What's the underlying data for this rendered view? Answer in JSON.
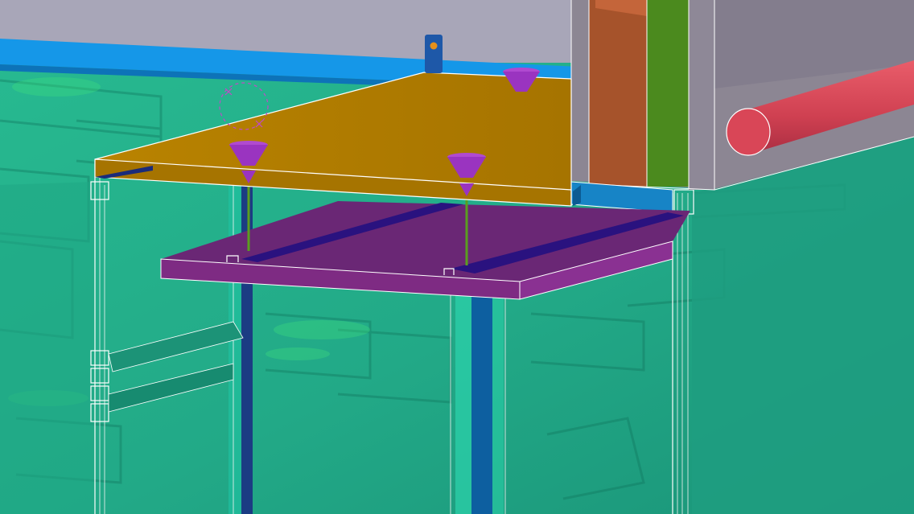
{
  "viewport": {
    "view_type": "3d-cad-model-view"
  },
  "colors": {
    "background_grey": "#a9a6b8",
    "blue_band": "#1597e8",
    "glass_teal": "#25b48e",
    "glass_deep": "#168d73",
    "slab_orange": "#b27d00",
    "slab_edge": "#9c6d00",
    "ceiling_purple": "#7e2b83",
    "ceiling_dark": "#5a2168",
    "channel_navy": "#2a127f",
    "cone_purple": "#9a34c0",
    "steel_grey": "#8c8693",
    "duct_orange": "#a6532b",
    "duct_green": "#4b8a1e",
    "pipe_red": "#d84a59",
    "column_blue": "#0d5fa0",
    "hanger_green": "#5b9d20",
    "frame_white": "#ffffff"
  },
  "model": {
    "parts": [
      "curtain-wall-glass",
      "floor-slab",
      "suspended-ceiling",
      "hanger-rod",
      "cone-anchor",
      "steel-column",
      "hvac-duct",
      "red-pipe",
      "mullion-frame"
    ]
  }
}
